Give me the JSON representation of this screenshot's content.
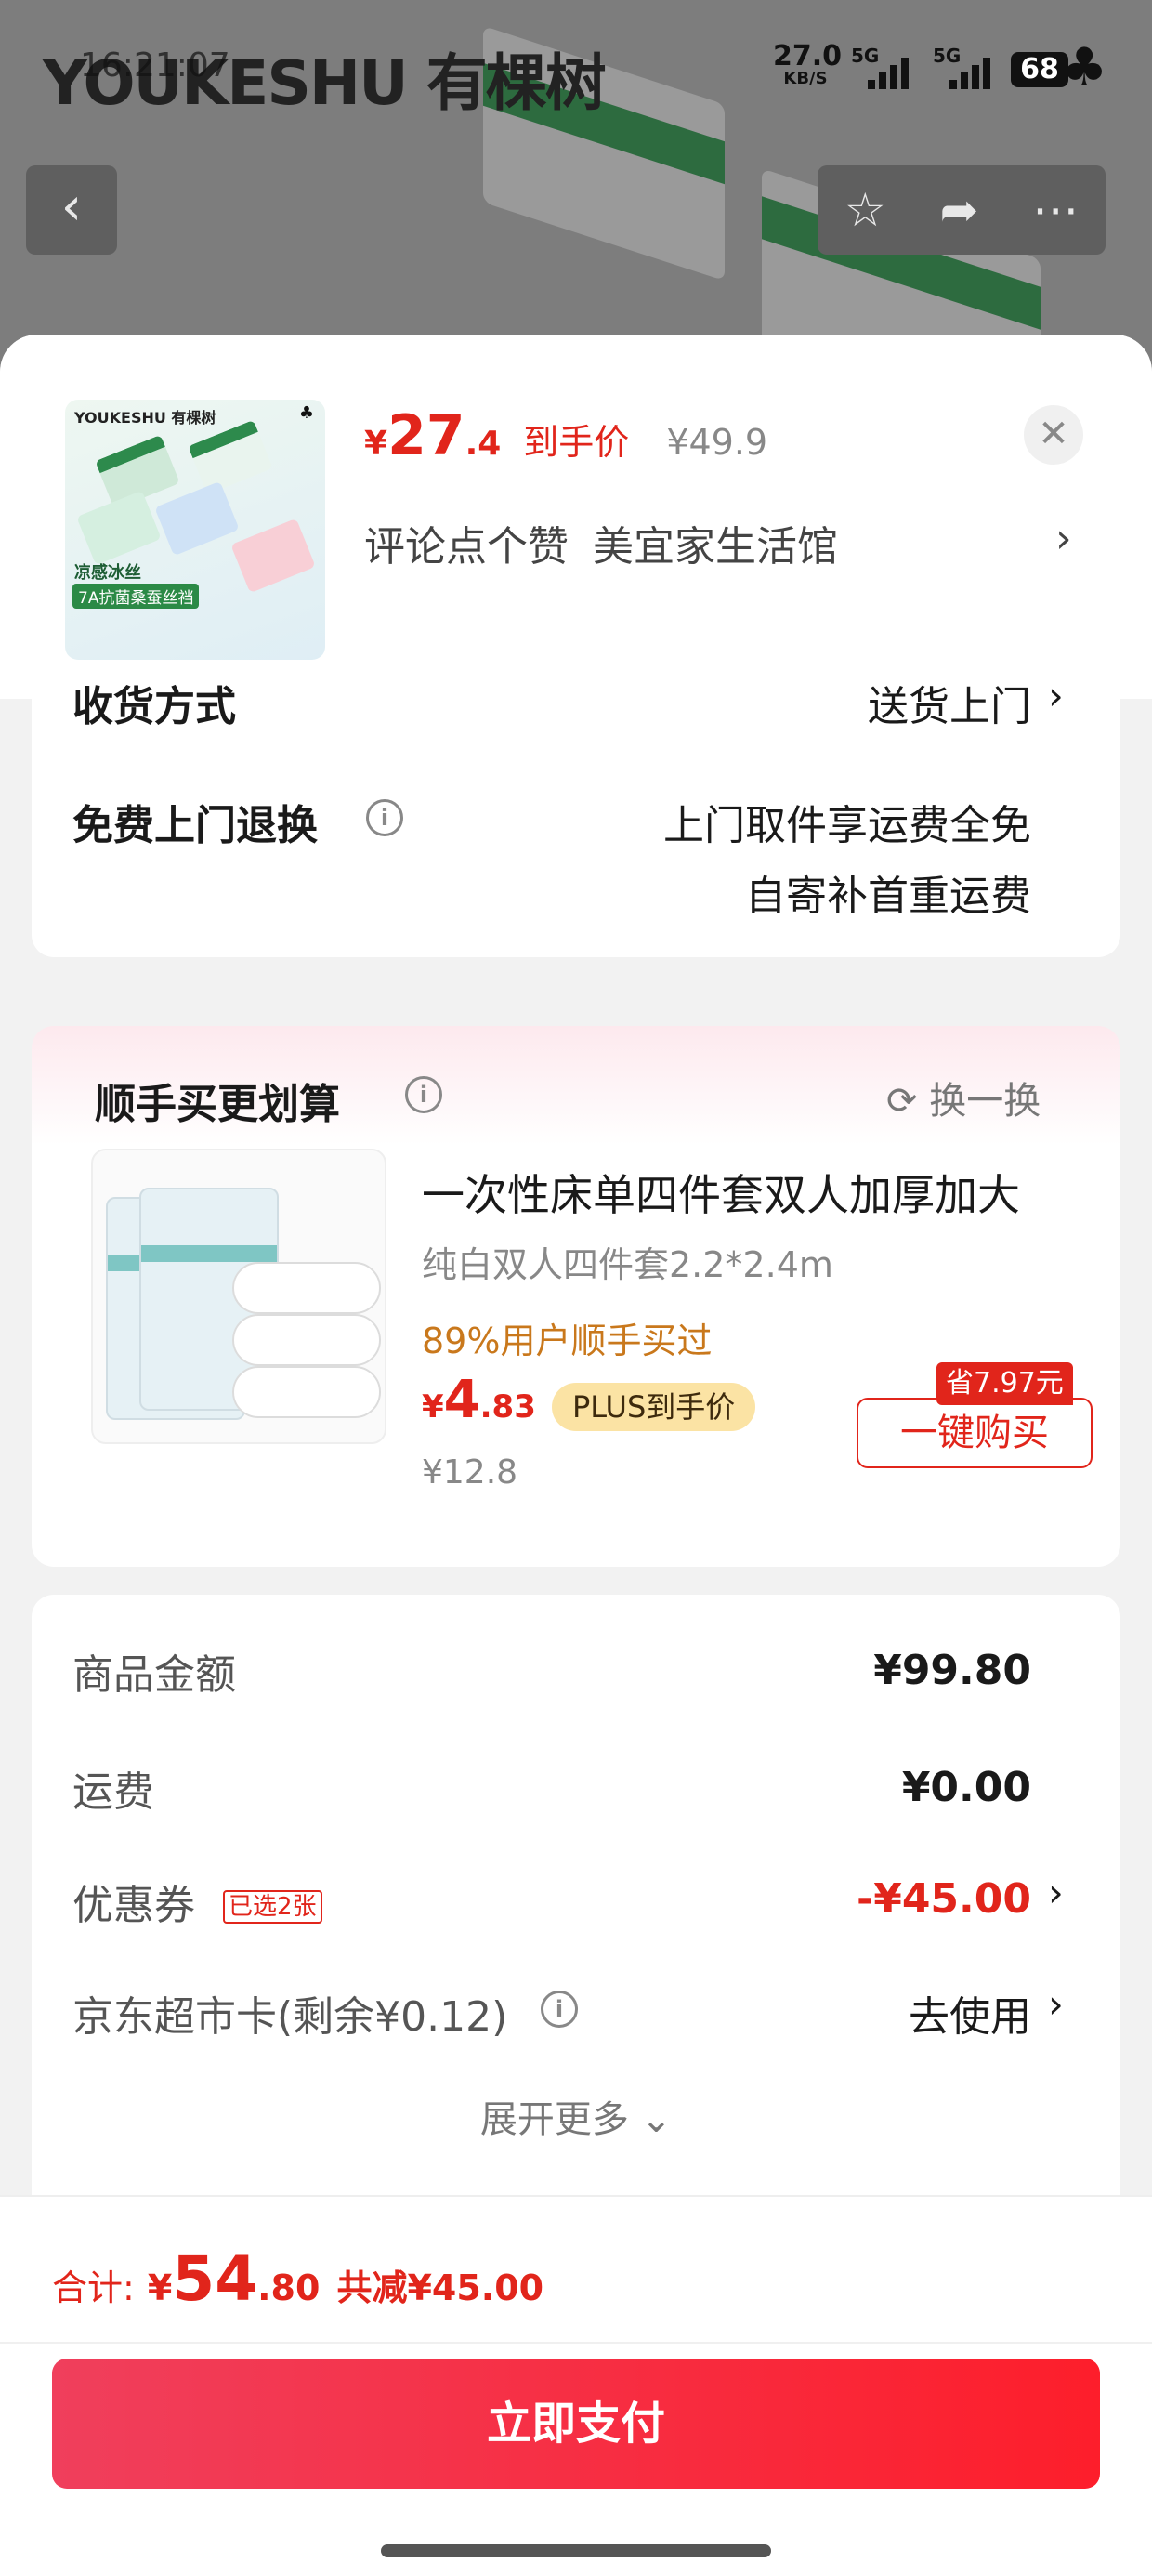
{
  "status_bar": {
    "brand": "YOUKESHU 有棵树",
    "time": "16:21:07",
    "net_speed": "27.0",
    "net_unit": "KB/S",
    "sig1": "5G",
    "sig2": "5G",
    "battery": "68"
  },
  "icons": {
    "back": "chevron-left",
    "favorite": "star-outline",
    "share": "share-arrow",
    "more": "ellipsis",
    "close": "close-x",
    "info": "info-circle",
    "refresh": "refresh-circle",
    "chevron": "chevron-right"
  },
  "product": {
    "currency": "¥",
    "price_int": "27",
    "price_dec": ".4",
    "price_label": "到手价",
    "original_price": "¥49.9",
    "promo": "评论点个赞",
    "shop": "美宜家生活馆",
    "thumb_logo": "YOUKESHU 有棵树",
    "thumb_tag1": "凉感冰丝",
    "thumb_tag2": "7A抗菌桑蚕丝裆"
  },
  "delivery": {
    "method_label": "收货方式",
    "method_value": "送货上门",
    "return_label": "免费上门退换",
    "return_line1": "上门取件享运费全免",
    "return_line2": "自寄补首重运费"
  },
  "upsell": {
    "title": "顺手买更划算",
    "swap": "换一换",
    "item_title": "一次性床单四件套双人加厚加大",
    "item_sub": "纯白双人四件套2.2*2.4m",
    "bought": "89%用户顺手买过",
    "currency": "¥",
    "price_int": "4",
    "price_dec": ".83",
    "plus_label": "PLUS到手价",
    "original": "¥12.8",
    "save_tag": "省7.97元",
    "buy_label": "一键购买"
  },
  "summary": {
    "goods_label": "商品金额",
    "goods_value": "¥99.80",
    "shipping_label": "运费",
    "shipping_value": "¥0.00",
    "coupon_label": "优惠券",
    "coupon_tag": "已选2张",
    "coupon_value": "-¥45.00",
    "card_label": "京东超市卡(剩余¥0.12)",
    "card_value": "去使用",
    "expand": "展开更多"
  },
  "footer": {
    "total_label": "合计:",
    "currency": "¥",
    "total_int": "54",
    "total_dec": ".80",
    "saved": "共减¥45.00",
    "pay_label": "立即支付"
  },
  "colors": {
    "accent_red": "#e1251b",
    "plus_gold": "#fbe3a4",
    "bought_orange": "#c9781c"
  }
}
